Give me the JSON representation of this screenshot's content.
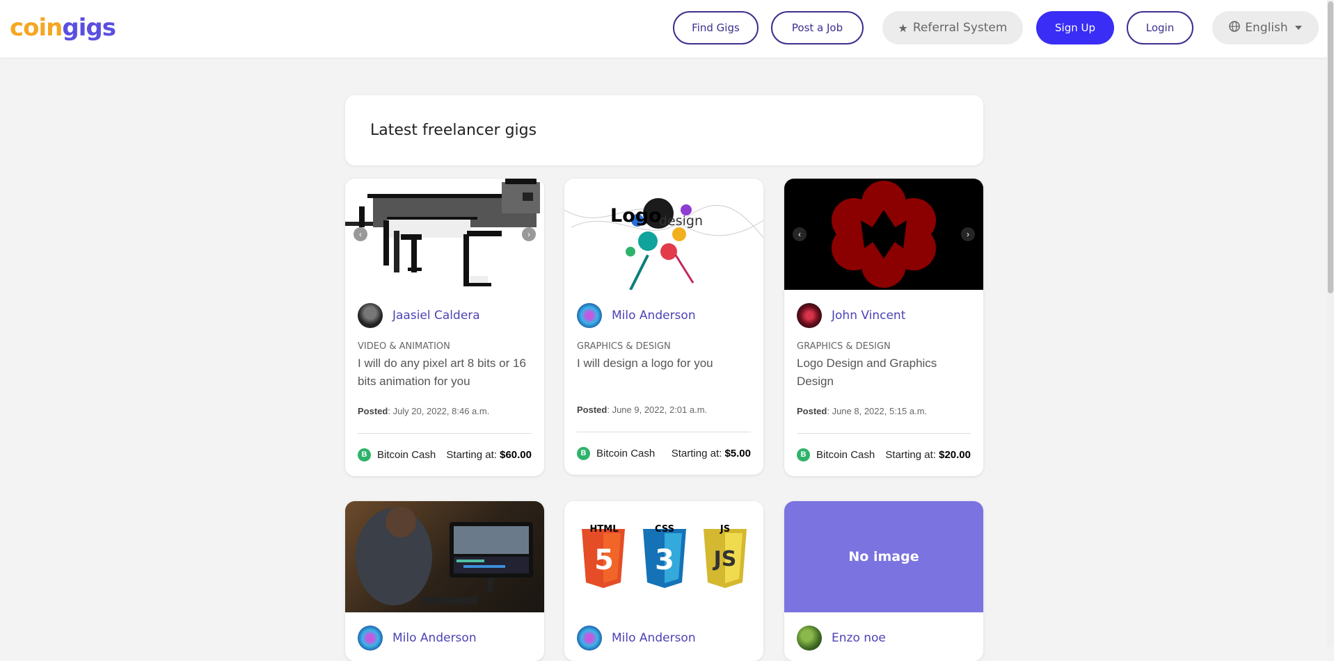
{
  "nav": {
    "logo_part1": "coin",
    "logo_part2": "gigs",
    "find_gigs": "Find Gigs",
    "post_job": "Post a Job",
    "referral": "Referral System",
    "sign_up": "Sign Up",
    "login": "Login",
    "language": "English"
  },
  "colors": {
    "primary": "#3a2df5",
    "brand_orange": "#f5a623",
    "brand_purple": "#5b4fe0",
    "link": "#4b42b5",
    "bitcoin_cash": "#2fb36b",
    "no_image_bg": "#7b73e0"
  },
  "page": {
    "heading": "Latest freelancer gigs"
  },
  "gigs": [
    {
      "author": "Jaasiel Caldera",
      "category": "VIDEO & ANIMATION",
      "title": "I will do any pixel art 8 bits or 16 bits animation for you",
      "posted_label": "Posted",
      "posted_date": ": July 20, 2022, 8:46 a.m.",
      "currency": "Bitcoin Cash",
      "currency_icon": "B",
      "starting_label": "Starting at:",
      "price": "$60.00",
      "image": "pixel-art-cat"
    },
    {
      "author": "Milo Anderson",
      "category": "GRAPHICS & DESIGN",
      "title": "I will design a logo for you",
      "posted_label": "Posted",
      "posted_date": ": June 9, 2022, 2:01 a.m.",
      "currency": "Bitcoin Cash",
      "currency_icon": "B",
      "starting_label": "Starting at:",
      "price": "$5.00",
      "image_text_main": "Logo",
      "image_text_sub": "design"
    },
    {
      "author": "John Vincent",
      "category": "GRAPHICS & DESIGN",
      "title": "Logo Design and Graphics Design",
      "posted_label": "Posted",
      "posted_date": ": June 8, 2022, 5:15 a.m.",
      "currency": "Bitcoin Cash",
      "currency_icon": "B",
      "starting_label": "Starting at:",
      "price": "$20.00",
      "image": "red-flower-logo"
    },
    {
      "author": "Milo Anderson",
      "image": "video-editing-desk"
    },
    {
      "author": "Milo Anderson",
      "image": "html-css-js-logos",
      "badges": [
        "HTML",
        "CSS",
        "JS"
      ],
      "badge_numbers": [
        "5",
        "3",
        "JS"
      ]
    },
    {
      "author": "Enzo noe",
      "no_image": "No image"
    }
  ]
}
